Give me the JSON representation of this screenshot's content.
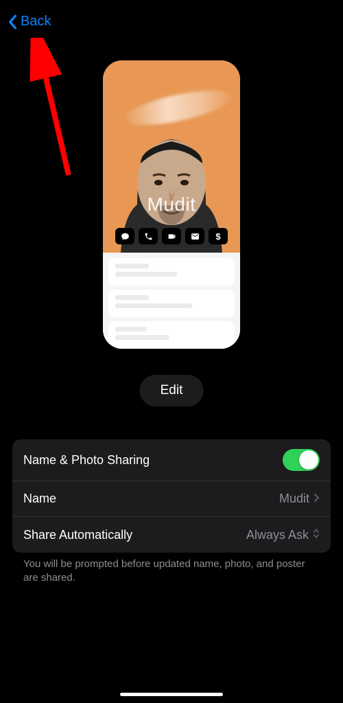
{
  "nav": {
    "back_label": "Back"
  },
  "card": {
    "name": "Mudit",
    "bg_color": "#e89854",
    "actions": {
      "message": "message-icon",
      "call": "phone-icon",
      "video": "video-icon",
      "mail": "mail-icon",
      "pay": "$"
    }
  },
  "edit": {
    "label": "Edit"
  },
  "settings": {
    "sharing": {
      "label": "Name & Photo Sharing",
      "enabled": true
    },
    "name": {
      "label": "Name",
      "value": "Mudit"
    },
    "share_auto": {
      "label": "Share Automatically",
      "value": "Always Ask"
    }
  },
  "footer": {
    "note": "You will be prompted before updated name, photo, and poster are shared."
  },
  "annotation": {
    "arrow_color": "#ff0000"
  }
}
